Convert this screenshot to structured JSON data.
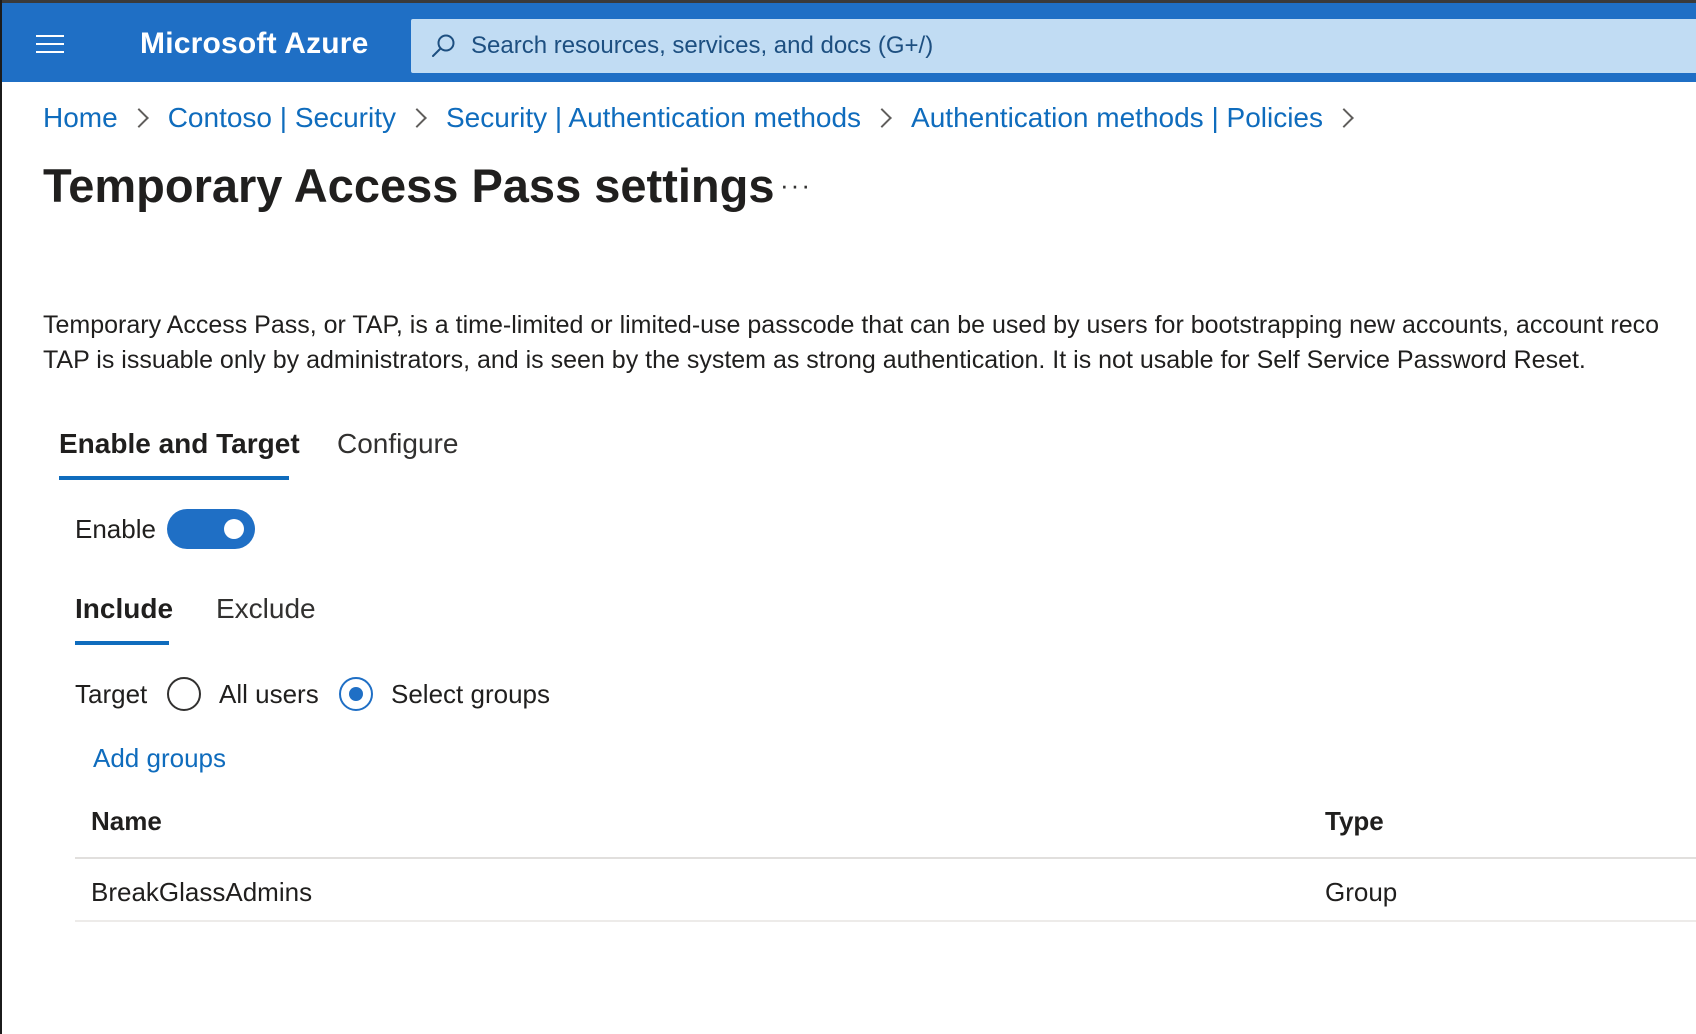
{
  "app": {
    "brand": "Microsoft Azure",
    "search_placeholder": "Search resources, services, and docs (G+/)"
  },
  "breadcrumb": [
    {
      "label": "Home"
    },
    {
      "label": "Contoso | Security"
    },
    {
      "label": "Security | Authentication methods"
    },
    {
      "label": "Authentication methods | Policies"
    }
  ],
  "page": {
    "title": "Temporary Access Pass settings",
    "more": "···",
    "description_line1": "Temporary Access Pass, or TAP, is a time-limited or limited-use passcode that can be used by users for bootstrapping new accounts, account reco",
    "description_line2": "TAP is issuable only by administrators, and is seen by the system as strong authentication. It is not usable for Self Service Password Reset."
  },
  "tabs": [
    {
      "label": "Enable and Target",
      "active": true
    },
    {
      "label": "Configure",
      "active": false
    }
  ],
  "enable": {
    "label": "Enable",
    "on": true
  },
  "subtabs": [
    {
      "label": "Include",
      "active": true
    },
    {
      "label": "Exclude",
      "active": false
    }
  ],
  "target": {
    "label": "Target",
    "options": [
      {
        "label": "All users",
        "checked": false
      },
      {
        "label": "Select groups",
        "checked": true
      }
    ]
  },
  "add_groups_label": "Add groups",
  "table": {
    "columns": [
      "Name",
      "Type"
    ],
    "rows": [
      {
        "name": "BreakGlassAdmins",
        "type": "Group"
      }
    ]
  },
  "colors": {
    "brand_blue": "#1f6fc5",
    "link_blue": "#0f6cbd",
    "search_bg": "#c1dcf3"
  }
}
